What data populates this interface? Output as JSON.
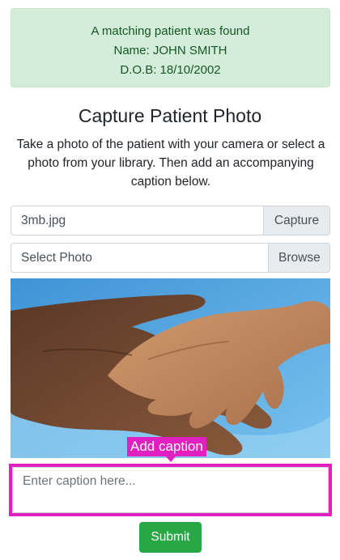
{
  "alert": {
    "line1": "A matching patient was found",
    "line2": "Name: JOHN SMITH",
    "line3": "D.O.B: 18/10/2002"
  },
  "page_title": "Capture Patient Photo",
  "description": "Take a photo of the patient with your camera or select a photo from your library. Then add an accompanying caption below.",
  "capture": {
    "value": "3mb.jpg",
    "button_label": "Capture"
  },
  "browse": {
    "value": "Select Photo",
    "button_label": "Browse"
  },
  "photo": {
    "subject": "hands-holding-child-hand"
  },
  "caption": {
    "tag_label": "Add caption",
    "placeholder": "Enter caption here..."
  },
  "submit_label": "Submit",
  "colors": {
    "alert_bg": "#d4edda",
    "alert_text": "#155724",
    "highlight": "#e020c0",
    "submit_bg": "#28a745",
    "addon_bg": "#e9ecef"
  }
}
